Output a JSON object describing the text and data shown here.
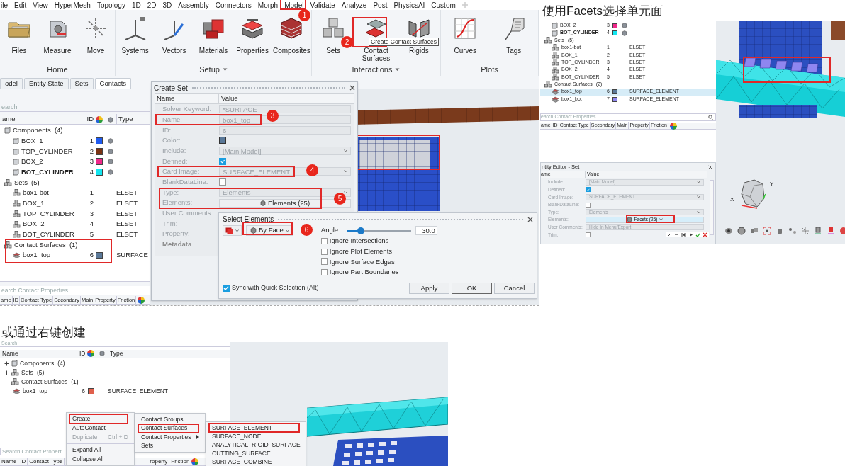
{
  "main_window": {
    "menu_bar": [
      "ile",
      "Edit",
      "View",
      "HyperMesh",
      "Topology",
      "1D",
      "2D",
      "3D",
      "Assembly",
      "Connectors",
      "Morph",
      "Model",
      "Validate",
      "Analyze",
      "Post",
      "PhysicsAI",
      "Custom"
    ],
    "ribbon": [
      {
        "group": "Home",
        "menu": false,
        "tools": [
          "Files",
          "Measure",
          "Move"
        ]
      },
      {
        "group": "Setup",
        "menu": true,
        "tools": [
          "Systems",
          "Vectors",
          "Materials",
          "Properties",
          "Composites"
        ]
      },
      {
        "group": "Interactions",
        "menu": true,
        "tools": [
          "Sets",
          "Contact Surfaces",
          "Rigids"
        ]
      },
      {
        "group": "Plots",
        "menu": false,
        "tools": [
          "Curves",
          "Tags"
        ]
      }
    ],
    "tooltip": "Create Contact Surfaces",
    "browser_tabs": [
      {
        "label": "odel",
        "selected": false
      },
      {
        "label": "Entity State",
        "selected": false
      },
      {
        "label": "Sets",
        "selected": false
      },
      {
        "label": "Contacts",
        "selected": true
      }
    ],
    "browser": {
      "search": {
        "placeholder": "earch"
      },
      "columns": [
        "ame",
        "ID",
        "Type"
      ],
      "tree": [
        {
          "kind": "components",
          "label": "Components",
          "count": "(4)",
          "children": [
            {
              "kind": "component",
              "label": "BOX_1",
              "id": "1",
              "color": "#1f5bf0",
              "current": false
            },
            {
              "kind": "component",
              "label": "TOP_CYLINDER",
              "id": "2",
              "color": "#7a3212",
              "current": false
            },
            {
              "kind": "component",
              "label": "BOX_2",
              "id": "3",
              "color": "#f0288a",
              "current": false
            },
            {
              "kind": "component",
              "label": "BOT_CYLINDER",
              "id": "4",
              "color": "#12e6f0",
              "current": true
            }
          ]
        },
        {
          "kind": "sets",
          "label": "Sets",
          "count": "(5)",
          "children": [
            {
              "kind": "set",
              "label": "box1-bot",
              "id": "1",
              "type": "ELSET"
            },
            {
              "kind": "set",
              "label": "BOX_1",
              "id": "2",
              "type": "ELSET"
            },
            {
              "kind": "set",
              "label": "TOP_CYLINDER",
              "id": "3",
              "type": "ELSET"
            },
            {
              "kind": "set",
              "label": "BOX_2",
              "id": "4",
              "type": "ELSET"
            },
            {
              "kind": "set",
              "label": "BOT_CYLINDER",
              "id": "5",
              "type": "ELSET"
            }
          ]
        },
        {
          "kind": "contact_surfaces",
          "label": "Contact Surfaces",
          "count": "(1)",
          "children": [
            {
              "kind": "contact_surface",
              "label": "box1_top",
              "id": "6",
              "color": "#5a7898",
              "type": "SURFACE"
            }
          ]
        }
      ]
    },
    "contact_properties": {
      "placeholder": "earch Contact Properties",
      "columns": [
        "ame",
        "ID",
        "Contact Type",
        "Secondary",
        "Main",
        "Property",
        "Friction"
      ]
    },
    "create_set": {
      "title": "Create Set",
      "columns": [
        "Name",
        "Value"
      ],
      "rows": [
        {
          "name": "Solver Keyword:",
          "kind": "text",
          "value": "*SURFACE"
        },
        {
          "name": "Name:",
          "kind": "text",
          "value": "box1_top"
        },
        {
          "name": "ID:",
          "kind": "text",
          "value": "6"
        },
        {
          "name": "Color:",
          "kind": "color",
          "color": "#5a7898"
        },
        {
          "name": "Include:",
          "kind": "dropdown",
          "value": "[Main Model]"
        },
        {
          "name": "Defined:",
          "kind": "checkbox",
          "checked": true
        },
        {
          "name": "Card Image:",
          "kind": "dropdown",
          "value": "SURFACE_ELEMENT"
        },
        {
          "name": "BlankDataLine:",
          "kind": "checkbox",
          "checked": false
        },
        {
          "name": "Type:",
          "kind": "dropdown",
          "value": "Elements"
        },
        {
          "name": "Elements:",
          "kind": "button",
          "value": "Elements (25)",
          "menu": false
        },
        {
          "name": "User Comments:",
          "kind": "empty"
        },
        {
          "name": "Trim:",
          "kind": "empty"
        },
        {
          "name": "Property:",
          "kind": "empty"
        },
        {
          "name": "Metadata",
          "kind": "section"
        }
      ]
    },
    "select_elements": {
      "title": "Select Elements",
      "mode": "By Face",
      "angle_label": "Angle:",
      "angle": {
        "level": 0.21
      },
      "angle_value": "30.0",
      "options": [
        {
          "label": "Ignore Intersections",
          "checked": false
        },
        {
          "label": "Ignore Plot Elements",
          "checked": false
        },
        {
          "label": "Ignore Surface Edges",
          "checked": false
        },
        {
          "label": "Ignore Part Boundaries",
          "checked": false
        }
      ],
      "sync": {
        "label": "Sync with Quick Selection (Alt)",
        "checked": true
      },
      "buttons": [
        "Apply",
        "OK",
        "Cancel"
      ]
    },
    "callouts": [
      "1",
      "2",
      "3",
      "4",
      "5",
      "6"
    ]
  },
  "facets_example": {
    "heading": "使用Facets选择单元面",
    "tree": [
      {
        "kind": "components",
        "children": [
          {
            "kind": "component",
            "label": "BOX_2",
            "id": "3",
            "color": "#f0288a",
            "current": false
          },
          {
            "kind": "component",
            "label": "BOT_CYLINDER",
            "id": "4",
            "color": "#12e6f0",
            "current": true
          }
        ]
      },
      {
        "kind": "sets",
        "label": "Sets",
        "count": "(5)",
        "children": [
          {
            "kind": "set",
            "label": "box1-bot",
            "id": "1",
            "type": "ELSET"
          },
          {
            "kind": "set",
            "label": "BOX_1",
            "id": "2",
            "type": "ELSET"
          },
          {
            "kind": "set",
            "label": "TOP_CYLINDER",
            "id": "3",
            "type": "ELSET"
          },
          {
            "kind": "set",
            "label": "BOX_2",
            "id": "4",
            "type": "ELSET"
          },
          {
            "kind": "set",
            "label": "BOT_CYLINDER",
            "id": "5",
            "type": "ELSET"
          }
        ]
      },
      {
        "kind": "contact_surfaces",
        "label": "Contact Surfaces",
        "count": "(2)",
        "children": [
          {
            "kind": "contact_surface",
            "label": "box1_top",
            "id": "6",
            "color": "#5a7898",
            "type": "SURFACE_ELEMENT",
            "selected": true
          },
          {
            "kind": "contact_surface",
            "label": "box1_bot",
            "id": "7",
            "color": "#8f86f0",
            "type": "SURFACE_ELEMENT",
            "selected": false
          }
        ]
      }
    ],
    "contact_properties": {
      "placeholder": "earch Contact Properties",
      "columns": [
        "ame",
        "ID",
        "Contact Type",
        "Secondary",
        "Main",
        "Property",
        "Friction"
      ]
    },
    "entity_editor": {
      "title": "ntity Editor - Set",
      "columns": [
        "ame",
        "Value"
      ],
      "rows": [
        {
          "name": "Include:",
          "kind": "dropdown",
          "value": "[Main Model]"
        },
        {
          "name": "Defined:",
          "kind": "checkbox",
          "checked": true
        },
        {
          "name": "Card Image:",
          "kind": "dropdown",
          "value": "SURFACE_ELEMENT"
        },
        {
          "name": "BlankDataLine:",
          "kind": "checkbox",
          "checked": false
        },
        {
          "name": "Type:",
          "kind": "dropdown",
          "value": "Elements"
        },
        {
          "name": "Elements:",
          "kind": "button",
          "value": "Facets (25)",
          "menu": true
        },
        {
          "name": "User Comments:",
          "kind": "text",
          "value": "Hide In Menu/Export"
        },
        {
          "name": "Trim:",
          "kind": "checkbox",
          "checked": false
        }
      ]
    },
    "axis_labels": [
      "Y",
      "X"
    ]
  },
  "context_menu_example": {
    "heading": "或通过右键创建",
    "browser": {
      "search": {
        "placeholder": "Search"
      },
      "columns": [
        "Name",
        "ID",
        "Type"
      ],
      "tree": [
        {
          "kind": "components",
          "label": "Components",
          "count": "(4)",
          "expanded": false
        },
        {
          "kind": "sets",
          "label": "Sets",
          "count": "(5)",
          "expanded": false
        },
        {
          "kind": "contact_surfaces",
          "label": "Contact Surfaces",
          "count": "(1)",
          "expanded": true,
          "children": [
            {
              "kind": "contact_surface",
              "label": "box1_top",
              "id": "6",
              "color": "#e0604c",
              "type": "SURFACE_ELEMENT"
            }
          ]
        }
      ]
    },
    "contact_properties": {
      "placeholder": "Search Contact Properti",
      "columns": [
        "Name",
        "ID",
        "Contact Type",
        "roperty",
        "Friction"
      ]
    },
    "menus": [
      [
        {
          "kind": "item",
          "label": "Create",
          "marked": true,
          "disabled": false
        },
        {
          "kind": "item",
          "label": "AutoContact",
          "marked": false,
          "disabled": false
        },
        {
          "kind": "item",
          "label": "Duplicate",
          "shortcut": "Ctrl + D",
          "marked": false,
          "disabled": true
        },
        {
          "kind": "separator"
        },
        {
          "kind": "item",
          "label": "Expand All",
          "marked": false,
          "disabled": false
        },
        {
          "kind": "item",
          "label": "Collapse All",
          "marked": false,
          "disabled": false
        }
      ],
      [
        {
          "kind": "item",
          "label": "Contact Groups",
          "marked": false,
          "disabled": false
        },
        {
          "kind": "item",
          "label": "Contact Surfaces",
          "marked": true,
          "disabled": false
        },
        {
          "kind": "submenu",
          "label": "Contact Properties",
          "marked": false,
          "disabled": false
        },
        {
          "kind": "item",
          "label": "Sets",
          "marked": false,
          "disabled": false
        }
      ],
      [
        {
          "kind": "item",
          "label": "SURFACE_ELEMENT",
          "marked": true,
          "disabled": false
        },
        {
          "kind": "item",
          "label": "SURFACE_NODE",
          "marked": false,
          "disabled": false
        },
        {
          "kind": "item",
          "label": "ANALYTICAL_RIGID_SURFACE",
          "marked": false,
          "disabled": false
        },
        {
          "kind": "item",
          "label": "CUTTING_SURFACE",
          "marked": false,
          "disabled": false
        },
        {
          "kind": "item",
          "label": "SURFACE_COMBINE",
          "marked": false,
          "disabled": false
        }
      ]
    ]
  }
}
